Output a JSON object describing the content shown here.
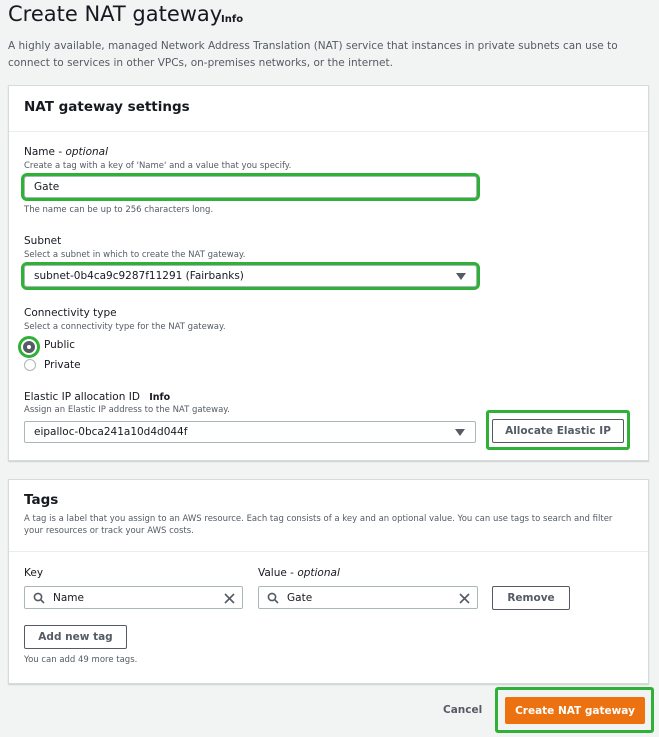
{
  "page": {
    "title": "Create NAT gateway",
    "title_info": "Info",
    "description": "A highly available, managed Network Address Translation (NAT) service that instances in private subnets can use to connect to services in other VPCs, on-premises networks, or the internet."
  },
  "settings": {
    "heading": "NAT gateway settings",
    "name": {
      "label": "Name - ",
      "label_optional": "optional",
      "hint": "Create a tag with a key of 'Name' and a value that you specify.",
      "value": "Gate",
      "constraint": "The name can be up to 256 characters long."
    },
    "subnet": {
      "label": "Subnet",
      "hint": "Select a subnet in which to create the NAT gateway.",
      "value": "subnet-0b4ca9c9287f11291 (Fairbanks)"
    },
    "connectivity": {
      "label": "Connectivity type",
      "hint": "Select a connectivity type for the NAT gateway.",
      "options": [
        "Public",
        "Private"
      ],
      "selected": "Public"
    },
    "elastic_ip": {
      "label": "Elastic IP allocation ID",
      "info": "Info",
      "hint": "Assign an Elastic IP address to the NAT gateway.",
      "value": "eipalloc-0bca241a10d4d044f",
      "allocate_button": "Allocate Elastic IP"
    }
  },
  "tags": {
    "heading": "Tags",
    "description": "A tag is a label that you assign to an AWS resource. Each tag consists of a key and an optional value. You can use tags to search and filter your resources or track your AWS costs.",
    "key_label": "Key",
    "value_label": "Value - ",
    "value_label_optional": "optional",
    "rows": [
      {
        "key": "Name",
        "value": "Gate"
      }
    ],
    "remove_button": "Remove",
    "add_button": "Add new tag",
    "limit_note": "You can add 49 more tags."
  },
  "footer": {
    "cancel": "Cancel",
    "submit": "Create NAT gateway"
  },
  "colors": {
    "highlight": "#2fb036",
    "primary": "#ec7211",
    "background": "#f2f3f3"
  },
  "icons": [
    "search-icon",
    "clear-icon",
    "dropdown-caret-icon",
    "radio-selected-icon",
    "radio-unselected-icon"
  ]
}
